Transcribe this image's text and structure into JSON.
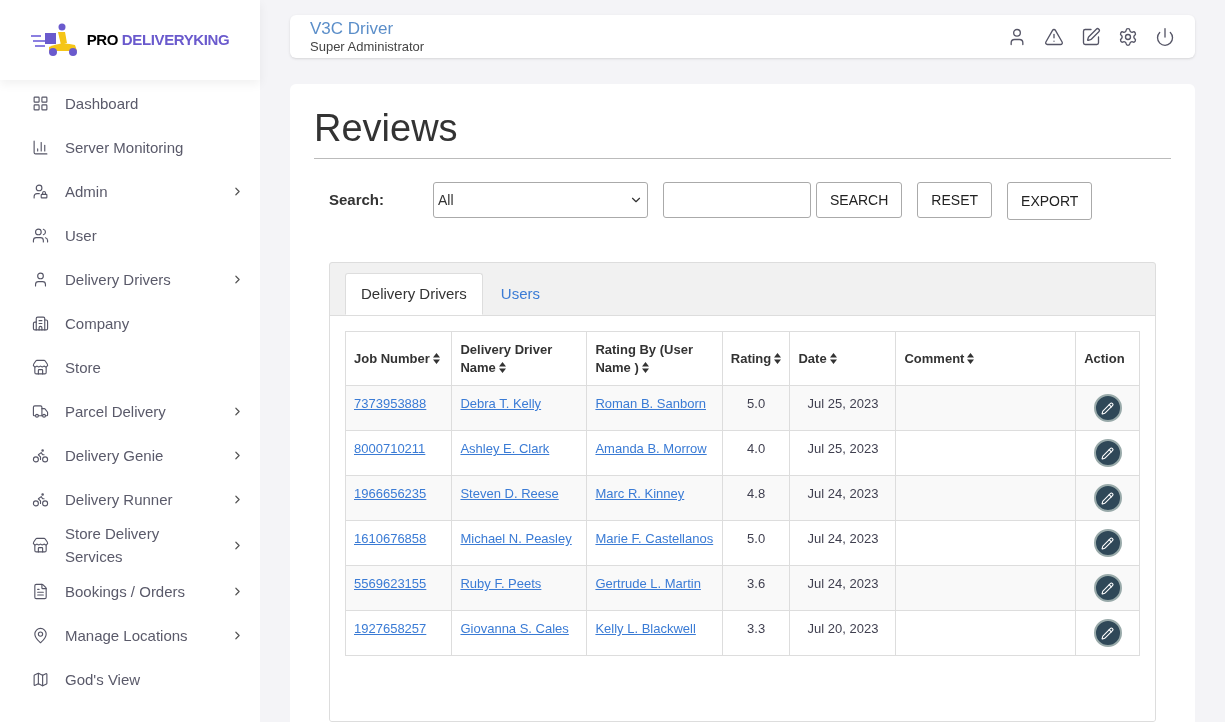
{
  "logo": {
    "text_1": "PRO",
    "text_2": "DELIVERYKING"
  },
  "sidebar": {
    "items": [
      {
        "label": "Dashboard",
        "expandable": false
      },
      {
        "label": "Server Monitoring",
        "expandable": false
      },
      {
        "label": "Admin",
        "expandable": true
      },
      {
        "label": "User",
        "expandable": false
      },
      {
        "label": "Delivery Drivers",
        "expandable": true
      },
      {
        "label": "Company",
        "expandable": false
      },
      {
        "label": "Store",
        "expandable": false
      },
      {
        "label": "Parcel Delivery",
        "expandable": true
      },
      {
        "label": "Delivery Genie",
        "expandable": true
      },
      {
        "label": "Delivery Runner",
        "expandable": true
      },
      {
        "label": "Store Delivery Services",
        "expandable": true
      },
      {
        "label": "Bookings / Orders",
        "expandable": true
      },
      {
        "label": "Manage Locations",
        "expandable": true
      },
      {
        "label": "God's View",
        "expandable": false
      }
    ]
  },
  "header": {
    "user_name": "V3C Driver",
    "role": "Super Administrator"
  },
  "page": {
    "title": "Reviews"
  },
  "search": {
    "label": "Search:",
    "select_value": "All",
    "buttons": [
      "SEARCH",
      "RESET",
      "EXPORT"
    ]
  },
  "tabs": [
    {
      "label": "Delivery Drivers",
      "selected": true
    },
    {
      "label": "Users",
      "selected": false
    }
  ],
  "table": {
    "columns": [
      {
        "label": "Job Number",
        "sortable": true
      },
      {
        "label": "Delivery Driver Name",
        "sortable": true
      },
      {
        "label": "Rating By (User Name )",
        "sortable": true
      },
      {
        "label": "Rating",
        "sortable": true
      },
      {
        "label": "Date",
        "sortable": true
      },
      {
        "label": "Comment",
        "sortable": true
      },
      {
        "label": "Action",
        "sortable": false
      }
    ],
    "rows": [
      {
        "job": "7373953888",
        "driver": "Debra T. Kelly",
        "user": "Roman B. Sanborn",
        "rating": "5.0",
        "date": "Jul 25, 2023"
      },
      {
        "job": "8000710211",
        "driver": "Ashley E. Clark",
        "user": "Amanda B. Morrow",
        "rating": "4.0",
        "date": "Jul 25, 2023"
      },
      {
        "job": "1966656235",
        "driver": "Steven D. Reese",
        "user": "Marc R. Kinney",
        "rating": "4.8",
        "date": "Jul 24, 2023"
      },
      {
        "job": "1610676858",
        "driver": "Michael N. Peasley",
        "user": "Marie F. Castellanos",
        "rating": "5.0",
        "date": "Jul 24, 2023"
      },
      {
        "job": "5569623155",
        "driver": "Ruby F. Peets",
        "user": "Gertrude L. Martin",
        "rating": "3.6",
        "date": "Jul 24, 2023"
      },
      {
        "job": "1927658257",
        "driver": "Giovanna S. Cales",
        "user": "Kelly L. Blackwell",
        "rating": "3.3",
        "date": "Jul 20, 2023"
      }
    ]
  }
}
